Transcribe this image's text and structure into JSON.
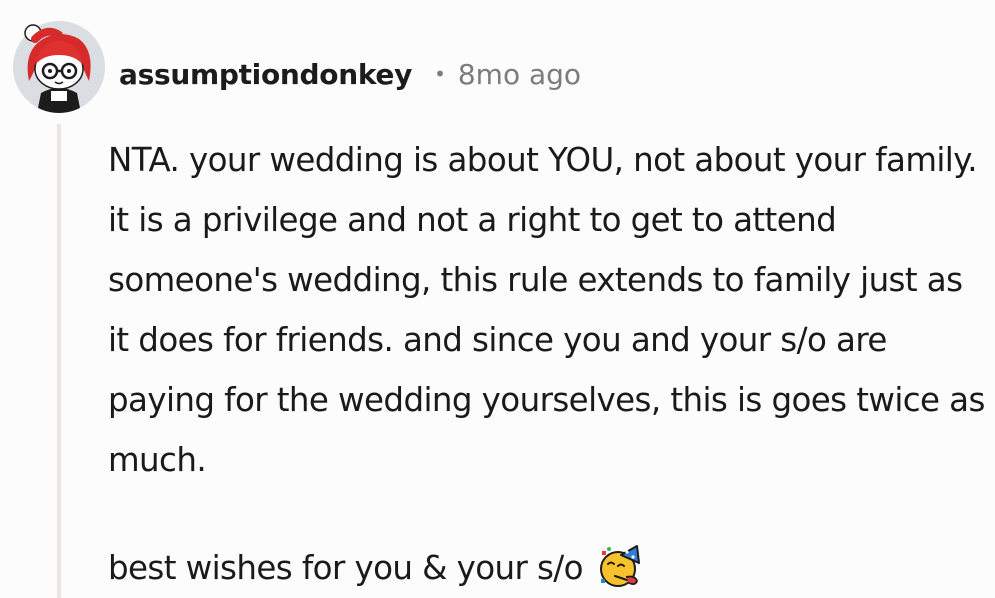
{
  "comment": {
    "username": "assumptiondonkey",
    "separator": "•",
    "timestamp": "8mo ago",
    "avatar_icon": "snoo-avatar-red-hair-glasses-icon",
    "paragraphs": [
      "NTA. your wedding is about YOU, not about your family. it is a privilege and not a right to get to attend someone's wedding, this rule extends to family just as it does for friends. and since you and your s/o are paying for the wedding yourselves, this is goes twice as much.",
      "best wishes for you & your s/o"
    ],
    "emoji_icon": "partying-face-emoji-icon"
  },
  "colors": {
    "background": "#fdfcfc",
    "thread_line": "#ebe5e2",
    "meta_text": "#7c7c7c",
    "body_text": "#1a1a1a"
  }
}
